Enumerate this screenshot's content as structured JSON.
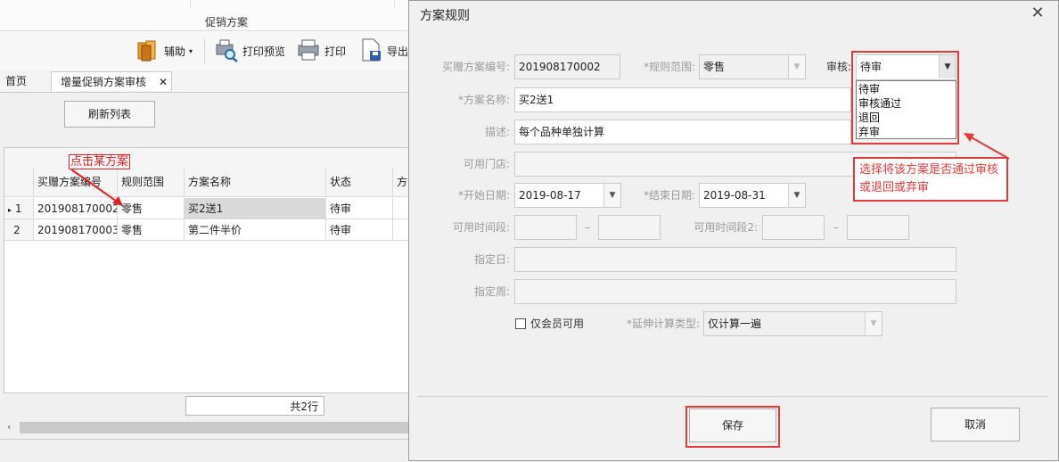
{
  "app": {
    "title": "促销方案",
    "toolbar": {
      "assist": "辅助",
      "print_preview": "打印预览",
      "print": "打印",
      "export": "导出"
    },
    "tabs": [
      {
        "label": "首页"
      },
      {
        "label": "增量促销方案审核"
      }
    ],
    "refresh_button": "刷新列表",
    "annotation_click": "点击某方案",
    "grid": {
      "headers": [
        "买赠方案编号",
        "规则范围",
        "方案名称",
        "状态",
        "方"
      ],
      "rows": [
        {
          "index": "1",
          "id": "201908170002",
          "scope": "零售",
          "name": "买2送1",
          "status": "待审"
        },
        {
          "index": "2",
          "id": "201908170003",
          "scope": "零售",
          "name": "第二件半价",
          "status": "待审"
        }
      ],
      "total": "共2行"
    }
  },
  "dialog": {
    "title": "方案规则",
    "fields": {
      "plan_no_label": "买赠方案编号:",
      "plan_no": "201908170002",
      "scope_label": "*规则范围:",
      "scope": "零售",
      "review_label": "审核:",
      "review": "待审",
      "name_label": "*方案名称:",
      "name": "买2送1",
      "desc_label": "描述:",
      "desc": "每个品种单独计算",
      "stores_label": "可用门店:",
      "start_label": "*开始日期:",
      "start": "2019-08-17",
      "end_label": "*结束日期:",
      "end": "2019-08-31",
      "period1_label": "可用时间段:",
      "period2_label": "可用时间段2:",
      "dash": "–",
      "days_label": "指定日:",
      "weeks_label": "指定周:",
      "member_only": "仅会员可用",
      "extend_type_label": "*延伸计算类型:",
      "extend_type": "仅计算一遍"
    },
    "review_options": [
      "待审",
      "审核通过",
      "退回",
      "弃审"
    ],
    "annotation": "选择将该方案是否通过审核或退回或弃审",
    "save": "保存",
    "cancel": "取消"
  },
  "colors": {
    "annotation": "#e03a3a",
    "selected_row": "#d9d9d9"
  }
}
